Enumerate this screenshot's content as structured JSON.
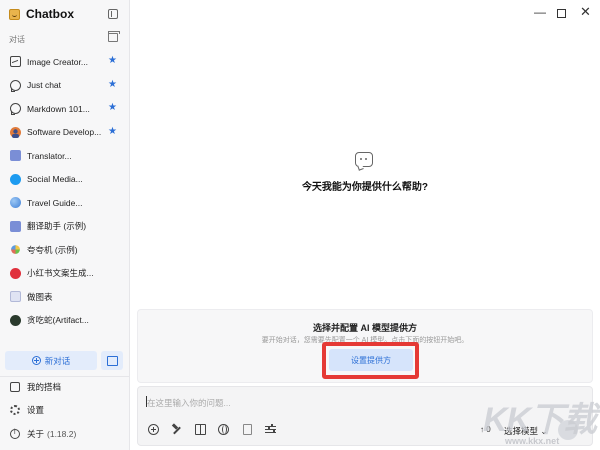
{
  "app": {
    "name": "Chatbox"
  },
  "sidebar": {
    "section_label": "对话",
    "items": [
      {
        "label": "Image Creator...",
        "icon": "image-icon",
        "starred": true
      },
      {
        "label": "Just chat",
        "icon": "chat-bubble-icon",
        "starred": true
      },
      {
        "label": "Markdown 101...",
        "icon": "chat-bubble-icon",
        "starred": true
      },
      {
        "label": "Software Develop...",
        "icon": "avatar-icon",
        "starred": true
      },
      {
        "label": "Translator...",
        "icon": "translate-icon",
        "starred": false
      },
      {
        "label": "Social Media...",
        "icon": "twitter-icon",
        "starred": false
      },
      {
        "label": "Travel Guide...",
        "icon": "globe-icon",
        "starred": false
      },
      {
        "label": "翻译助手 (示例)",
        "icon": "translate-icon",
        "starred": false
      },
      {
        "label": "夸夸机 (示例)",
        "icon": "sparkle-icon",
        "starred": false
      },
      {
        "label": "小红书文案生成...",
        "icon": "xiaohongshu-icon",
        "starred": false
      },
      {
        "label": "做图表",
        "icon": "chart-icon",
        "starred": false
      },
      {
        "label": "贪吃蛇(Artifact...",
        "icon": "snake-avatar-icon",
        "starred": false
      }
    ],
    "star_glyph": "★",
    "new_chat_label": "新对话",
    "bottom": {
      "copilots_label": "我的搭档",
      "settings_label": "设置",
      "about_label": "关于",
      "version": "(1.18.2)"
    }
  },
  "window_controls": {
    "minimize": "—",
    "close": "✕"
  },
  "main": {
    "welcome": "今天我能为你提供什么帮助?",
    "setup": {
      "title": "选择并配置 AI 模型提供方",
      "description": "要开始对话，您需要先配置一个 AI 模型。点击下面的按钮开始吧。",
      "button_label": "设置提供方"
    },
    "input": {
      "placeholder": "在这里输入你的问题...",
      "token_count": "↑ 0",
      "model_label": "选择模型",
      "model_arrow": "⌄"
    }
  },
  "watermark": {
    "main": "KK下载",
    "url": "www.kkx.net"
  },
  "colors": {
    "accent": "#2c6fd6",
    "highlight": "#e53935",
    "sidebar_bg": "#f7f7f8"
  }
}
